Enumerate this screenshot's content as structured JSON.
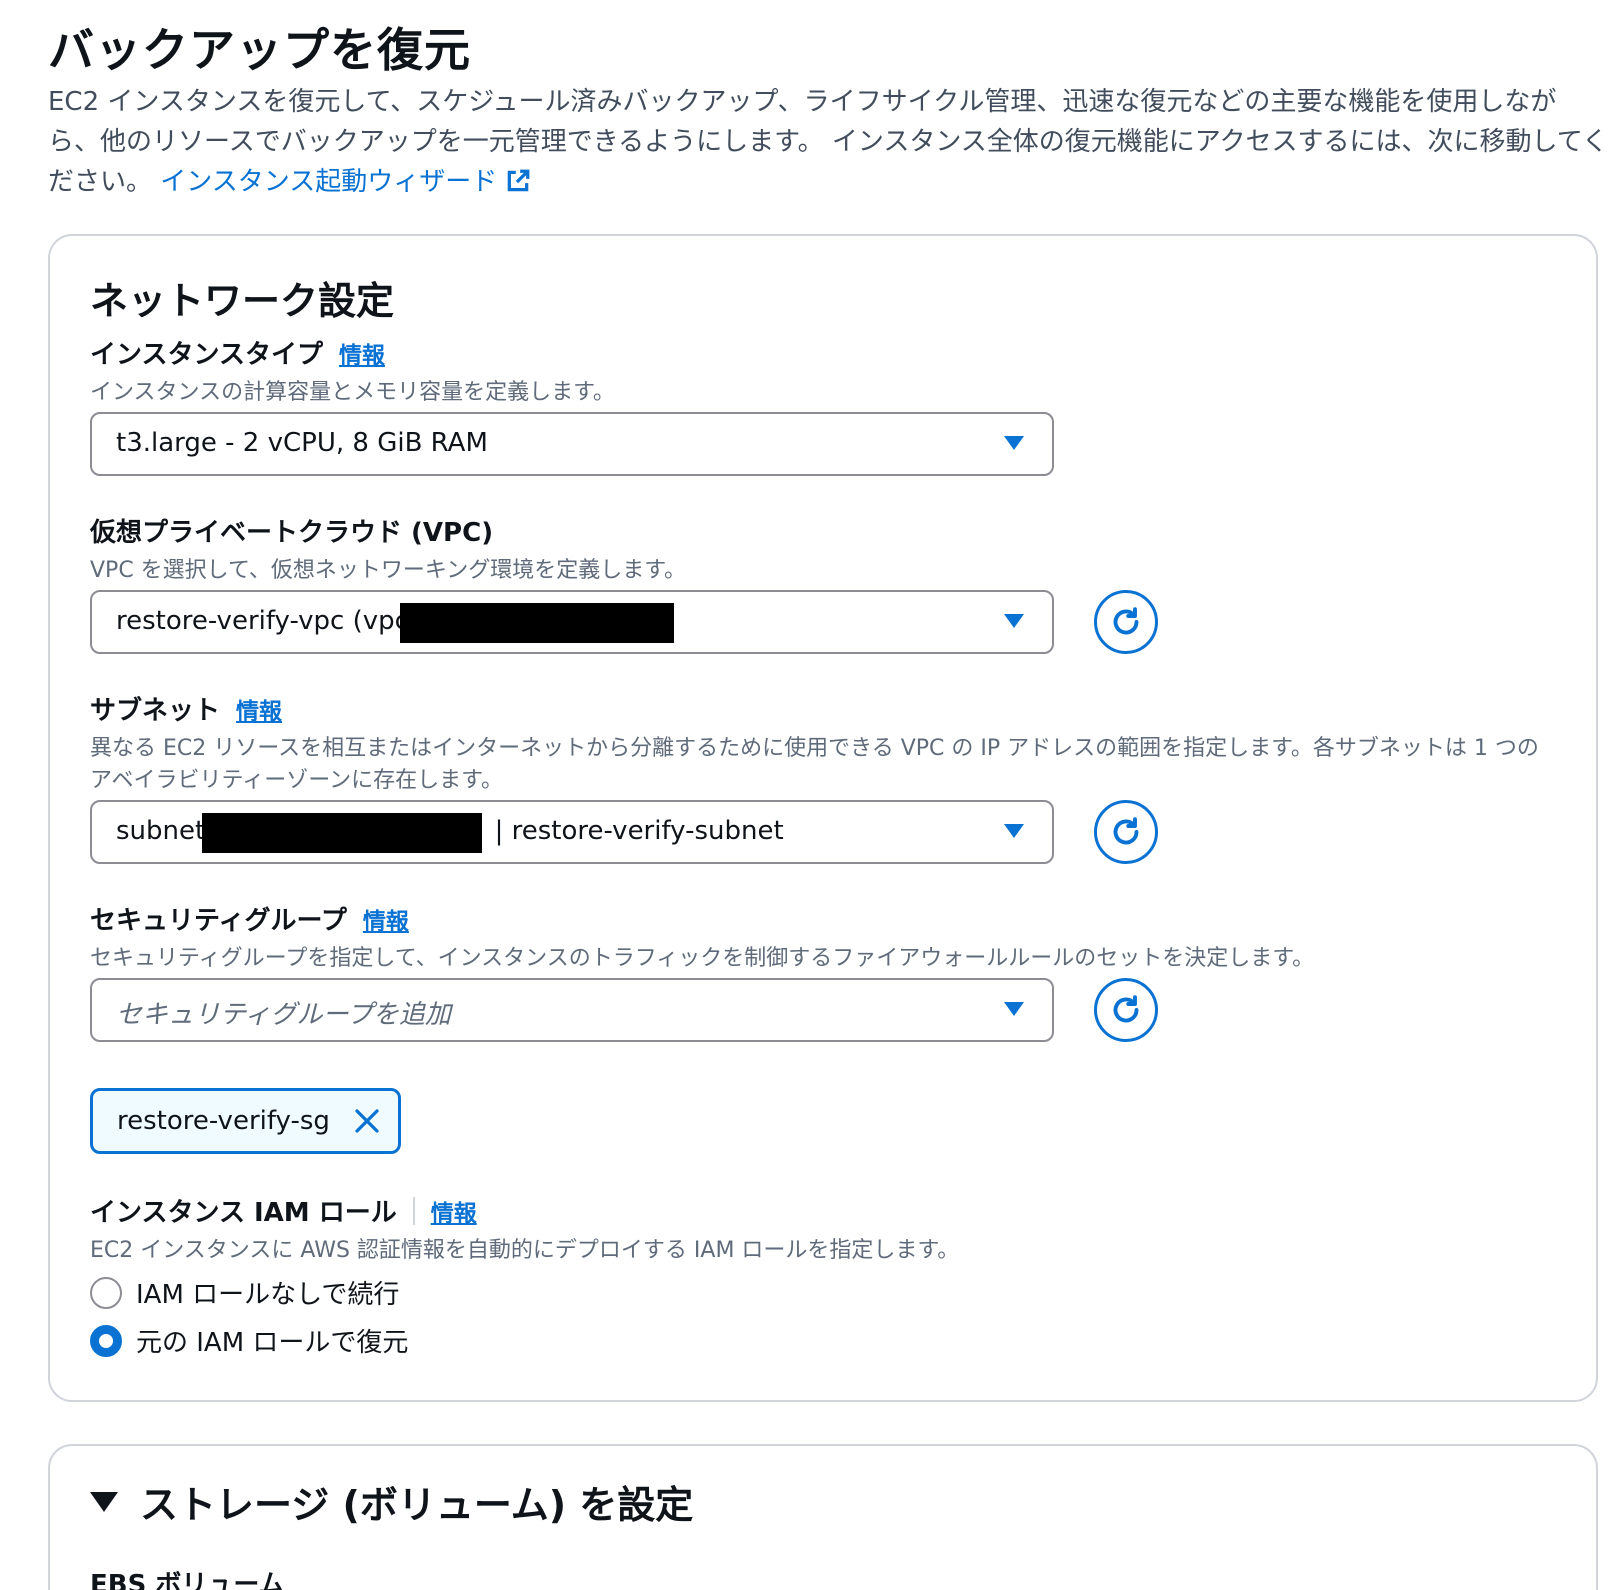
{
  "page": {
    "title": "バックアップを復元",
    "description": "EC2 インスタンスを復元して、スケジュール済みバックアップ、ライフサイクル管理、迅速な復元などの主要な機能を使用しながら、他のリソースでバックアップを一元管理できるようにします。 インスタンス全体の復元機能にアクセスするには、次に移動してください。",
    "wizard_link": "インスタンス起動ウィザード"
  },
  "network": {
    "title": "ネットワーク設定",
    "info": "情報",
    "instance_type": {
      "label": "インスタンスタイプ",
      "description": "インスタンスの計算容量とメモリ容量を定義します。",
      "value": "t3.large - 2 vCPU, 8 GiB RAM"
    },
    "vpc": {
      "label": "仮想プライベートクラウド (VPC)",
      "description": "VPC を選択して、仮想ネットワーキング環境を定義します。",
      "value": "restore-verify-vpc (vpc-"
    },
    "subnet": {
      "label": "サブネット",
      "description": "異なる EC2 リソースを相互またはインターネットから分離するために使用できる VPC の IP アドレスの範囲を指定します。各サブネットは 1 つのアベイラビリティーゾーンに存在します。",
      "value_prefix": "subnet-",
      "value_suffix": "| restore-verify-subnet"
    },
    "security_group": {
      "label": "セキュリティグループ",
      "description": "セキュリティグループを指定して、インスタンスのトラフィックを制御するファイアウォールルールのセットを決定します。",
      "placeholder": "セキュリティグループを追加",
      "selected": "restore-verify-sg"
    },
    "iam_role": {
      "label": "インスタンス IAM ロール",
      "description": "EC2 インスタンスに AWS 認証情報を自動的にデプロイする IAM ロールを指定します。",
      "options": [
        {
          "label": "IAM ロールなしで続行",
          "checked": false
        },
        {
          "label": "元の IAM ロールで復元",
          "checked": true
        }
      ]
    }
  },
  "storage": {
    "title": "ストレージ (ボリューム) を設定",
    "ebs_label": "EBS ボリューム"
  },
  "colors": {
    "accent": "#0972d3",
    "border": "#8c8c94",
    "text": "#0f141a",
    "secondary_text": "#5f6b7a"
  },
  "icons": [
    "external-link-icon",
    "caret-down-icon",
    "refresh-icon",
    "close-icon",
    "expand-caret-icon"
  ]
}
